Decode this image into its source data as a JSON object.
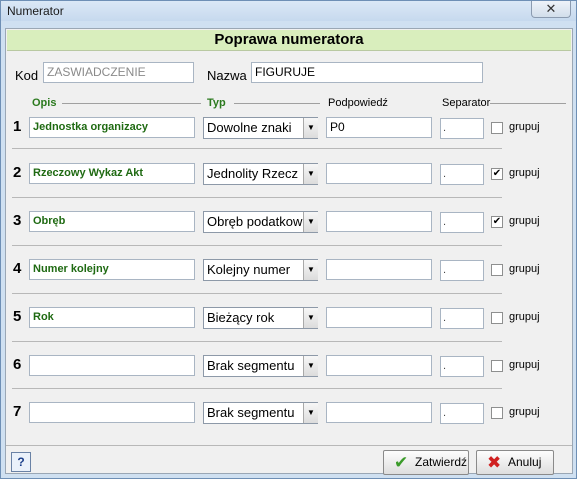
{
  "window": {
    "title": "Numerator",
    "close_glyph": "✕"
  },
  "header": {
    "title": "Poprawa numeratora"
  },
  "kod": {
    "label": "Kod",
    "value": "ZASWIADCZENIE"
  },
  "nazwa": {
    "label": "Nazwa",
    "value": "FIGURUJE"
  },
  "columns": {
    "opis": "Opis",
    "typ": "Typ",
    "podpowiedz": "Podpowiedź",
    "separator": "Separator"
  },
  "dropdown_arrow": "▼",
  "check_mark": "✔",
  "rows": [
    {
      "num": "1",
      "opis": "Jednostka organizacy",
      "typ": "Dowolne znaki",
      "podpowiedz": "P0",
      "separator": ".",
      "grupuj_checked": false,
      "grupuj_label": "grupuj"
    },
    {
      "num": "2",
      "opis": "Rzeczowy Wykaz Akt",
      "typ": "Jednolity Rzecz",
      "podpowiedz": "",
      "separator": ".",
      "grupuj_checked": true,
      "grupuj_label": "grupuj"
    },
    {
      "num": "3",
      "opis": "Obręb",
      "typ": "Obręb podatkow",
      "podpowiedz": "",
      "separator": ".",
      "grupuj_checked": true,
      "grupuj_label": "grupuj"
    },
    {
      "num": "4",
      "opis": "Numer kolejny",
      "typ": "Kolejny numer",
      "podpowiedz": "",
      "separator": ".",
      "grupuj_checked": false,
      "grupuj_label": "grupuj"
    },
    {
      "num": "5",
      "opis": "Rok",
      "typ": "Bieżący rok",
      "podpowiedz": "",
      "separator": ".",
      "grupuj_checked": false,
      "grupuj_label": "grupuj"
    },
    {
      "num": "6",
      "opis": "",
      "typ": "Brak segmentu",
      "podpowiedz": "",
      "separator": ".",
      "grupuj_checked": false,
      "grupuj_label": "grupuj"
    },
    {
      "num": "7",
      "opis": "",
      "typ": "Brak segmentu",
      "podpowiedz": "",
      "separator": ".",
      "grupuj_checked": false,
      "grupuj_label": "grupuj"
    }
  ],
  "footer": {
    "help_label": "?",
    "confirm_label": "Zatwierdź",
    "confirm_icon": "✔",
    "cancel_label": "Anuluj",
    "cancel_icon": "✖"
  },
  "colors": {
    "header_band": "#d9eebd",
    "opis_text": "#1f6a12",
    "confirm_icon": "#3b9b2a",
    "cancel_icon": "#d02020"
  }
}
